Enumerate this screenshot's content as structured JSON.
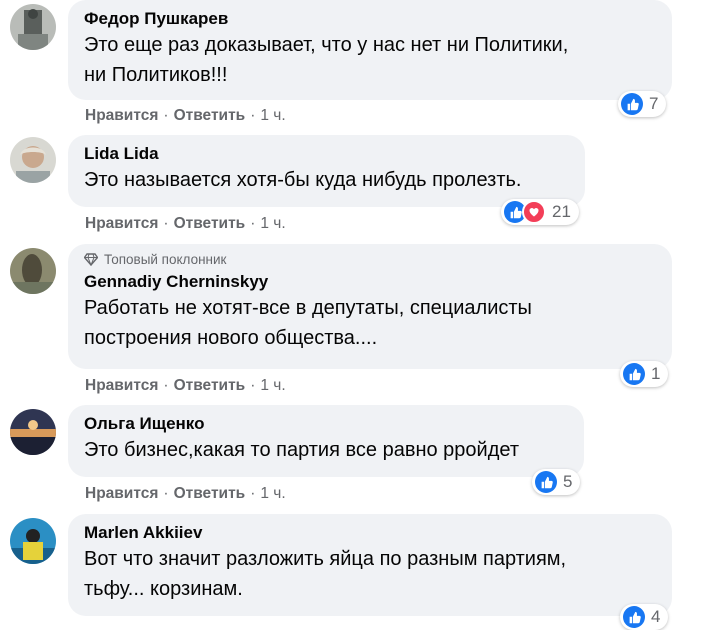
{
  "colors": {
    "bubble": "#f0f2f5",
    "like": "#1877f2",
    "love": "#f33e58",
    "meta": "#65676b"
  },
  "actions": {
    "like": "Нравится",
    "reply": "Ответить",
    "sep": "·"
  },
  "comments": [
    {
      "author": "Федор Пушкарев",
      "text": "Это еще раз доказывает, что у нас нет ни Политики,\nни Политиков!!!",
      "time": "1 ч.",
      "reaction_count": "7",
      "reactions": [
        "like-icon"
      ]
    },
    {
      "author": "Lida Lida",
      "text": "Это называется хотя-бы куда нибудь пролезть.",
      "time": "1 ч.",
      "reaction_count": "21",
      "reactions": [
        "like-icon",
        "love-icon"
      ]
    },
    {
      "badge": "Топовый поклонник",
      "author": "Gennadiy Cherninskyy",
      "text": "Работать не хотят-все в депутаты, специалисты\nпостроения нового общества....",
      "time": "1 ч.",
      "reaction_count": "1",
      "reactions": [
        "like-icon"
      ]
    },
    {
      "author": "Ольга Ищенко",
      "text": "Это бизнес,какая то партия все равно рройдет",
      "time": "1 ч.",
      "reaction_count": "5",
      "reactions": [
        "like-icon"
      ]
    },
    {
      "author": "Marlen Akkiiev",
      "text": "Вот что значит разложить яйца по разным партиям,\nтьфу... корзинам.",
      "time": "",
      "reaction_count": "4",
      "reactions": [
        "like-icon"
      ]
    }
  ]
}
